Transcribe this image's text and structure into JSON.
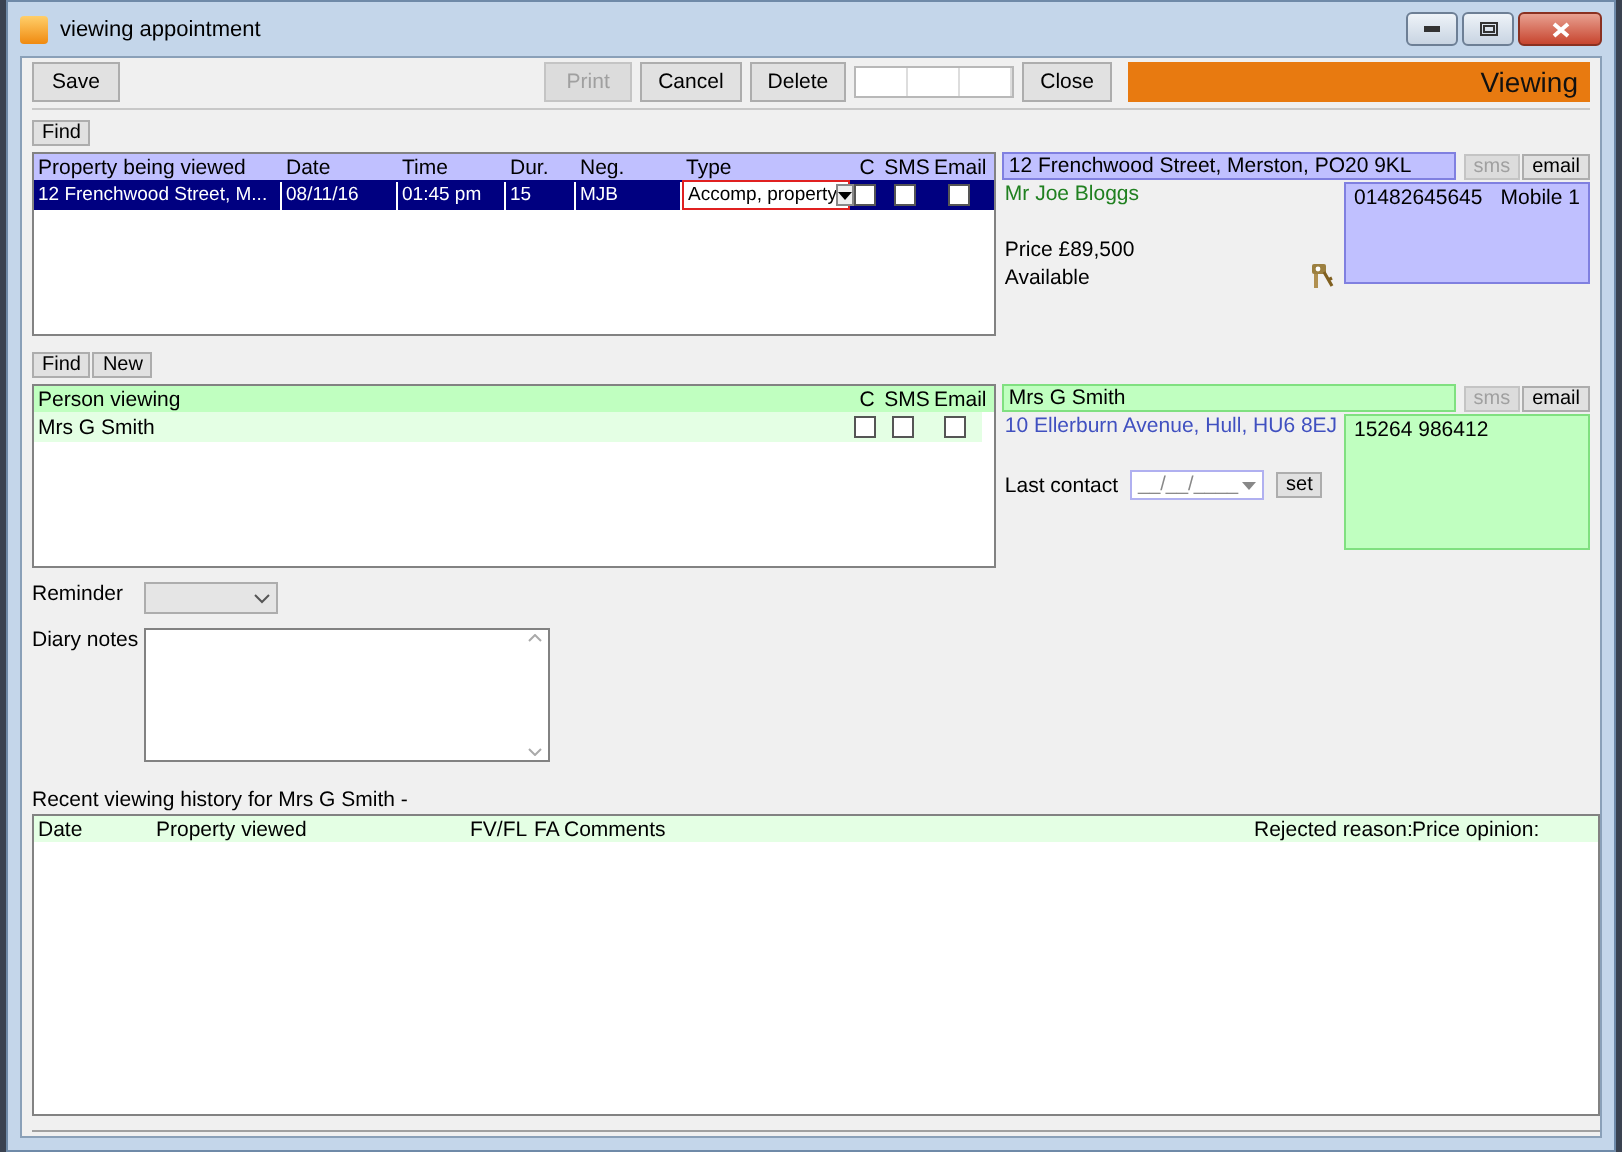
{
  "window": {
    "title": "viewing appointment"
  },
  "toolbar": {
    "buttons": [
      {
        "label": "Save",
        "disabled": false,
        "kind": "button"
      },
      {
        "label": "Print",
        "disabled": true,
        "kind": "button"
      },
      {
        "label": "Cancel",
        "disabled": false,
        "kind": "button"
      },
      {
        "label": "Delete",
        "disabled": false,
        "kind": "button"
      },
      {
        "kind": "segments"
      },
      {
        "label": "Close",
        "disabled": false,
        "kind": "button"
      }
    ],
    "banner": "Viewing"
  },
  "property_grid": {
    "find_button": "Find",
    "columns": [
      "Property being viewed",
      "Date",
      "Time",
      "Dur.",
      "Neg.",
      "Type",
      "C",
      "SMS",
      "Email"
    ],
    "rows": [
      {
        "cells": [
          "12 Frenchwood Street, M...",
          "08/11/16",
          "01:45 pm",
          "15",
          "MJB"
        ],
        "type": "Accomp, property",
        "c": false,
        "sms": false,
        "email": false,
        "selected": true
      }
    ]
  },
  "property_details": {
    "address": "12 Frenchwood Street, Merston, PO20 9KL",
    "buttons": [
      {
        "label": "sms",
        "disabled": true
      },
      {
        "label": "email",
        "disabled": false
      }
    ],
    "contact": "Mr Joe Bloggs",
    "price": "Price £89,500",
    "status": "Available",
    "phone": "01482645645",
    "phone_label": "Mobile 1"
  },
  "person_grid": {
    "buttons": [
      "Find",
      "New"
    ],
    "columns": [
      "Person viewing",
      "C",
      "SMS",
      "Email"
    ],
    "rows": [
      {
        "name": "Mrs G Smith",
        "c": false,
        "sms": false,
        "email": false
      }
    ]
  },
  "person_details": {
    "name": "Mrs G Smith",
    "buttons": [
      {
        "label": "sms",
        "disabled": true
      },
      {
        "label": "email",
        "disabled": false
      }
    ],
    "address": "10 Ellerburn Avenue, Hull, HU6 8EJ",
    "phone": "15264 986412",
    "last_contact_label": "Last contact",
    "last_contact_placeholder": "__/__/____",
    "set_button": "set"
  },
  "reminder": {
    "label": "Reminder"
  },
  "diary_notes": {
    "label": "Diary notes"
  },
  "history": {
    "title": "Recent viewing history for  Mrs G Smith -",
    "columns": [
      "Date",
      "Property viewed",
      "FV/FL",
      "FA",
      "Comments",
      "Rejected reason:",
      "Price opinion:"
    ]
  }
}
